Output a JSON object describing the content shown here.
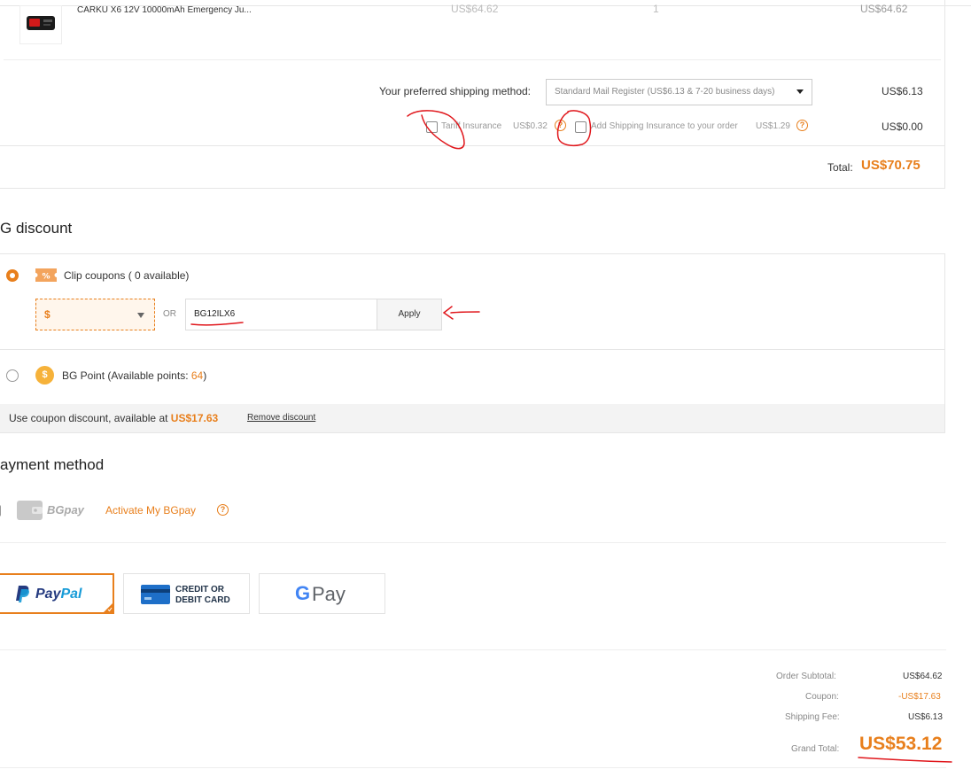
{
  "product": {
    "name": "CARKU X6 12V 10000mAh Emergency Ju...",
    "unit_price": "US$64.62",
    "quantity": "1",
    "line_total": "US$64.62"
  },
  "shipping": {
    "label": "Your preferred shipping method:",
    "selected": "Standard Mail Register (US$6.13 & 7-20 business days)",
    "cost": "US$6.13",
    "tariff_label": "Tariff Insurance",
    "tariff_price": "US$0.32",
    "insurance_label": "Add Shipping Insurance to your order",
    "insurance_price": "US$1.29",
    "extras_cost": "US$0.00"
  },
  "total": {
    "label": "Total:",
    "value": "US$70.75"
  },
  "discount": {
    "heading": "G discount",
    "clip_label": "Clip coupons ( 0 available)",
    "currency_value": "$",
    "or_label": "OR",
    "coupon_code": "BG12ILX6",
    "apply_label": "Apply",
    "point_label": "BG Point (Available points: ",
    "point_value": "64",
    "point_close": ")",
    "use_label": "Use coupon discount, available at ",
    "use_value": "US$17.63",
    "remove_label": "Remove discount"
  },
  "payment": {
    "heading": "ayment method",
    "bgpay_label": "BGpay",
    "activate_label": "Activate My BGpay",
    "paypal_pay": "Pay",
    "paypal_pal": "Pal",
    "card_line1": "CREDIT OR",
    "card_line2": "DEBIT CARD",
    "gpay_g": "G",
    "gpay_pay": "Pay"
  },
  "summary": {
    "subtotal_label": "Order Subtotal:",
    "subtotal_value": "US$64.62",
    "coupon_label": "Coupon:",
    "coupon_value": "-US$17.63",
    "shipping_label": "Shipping Fee:",
    "shipping_value": "US$6.13",
    "grand_label": "Grand Total:",
    "grand_value": "US$53.12"
  },
  "colors": {
    "accent": "#e87f1c",
    "annotation": "#e0161b",
    "paypal_dark": "#253b80",
    "paypal_light": "#179bd7"
  }
}
